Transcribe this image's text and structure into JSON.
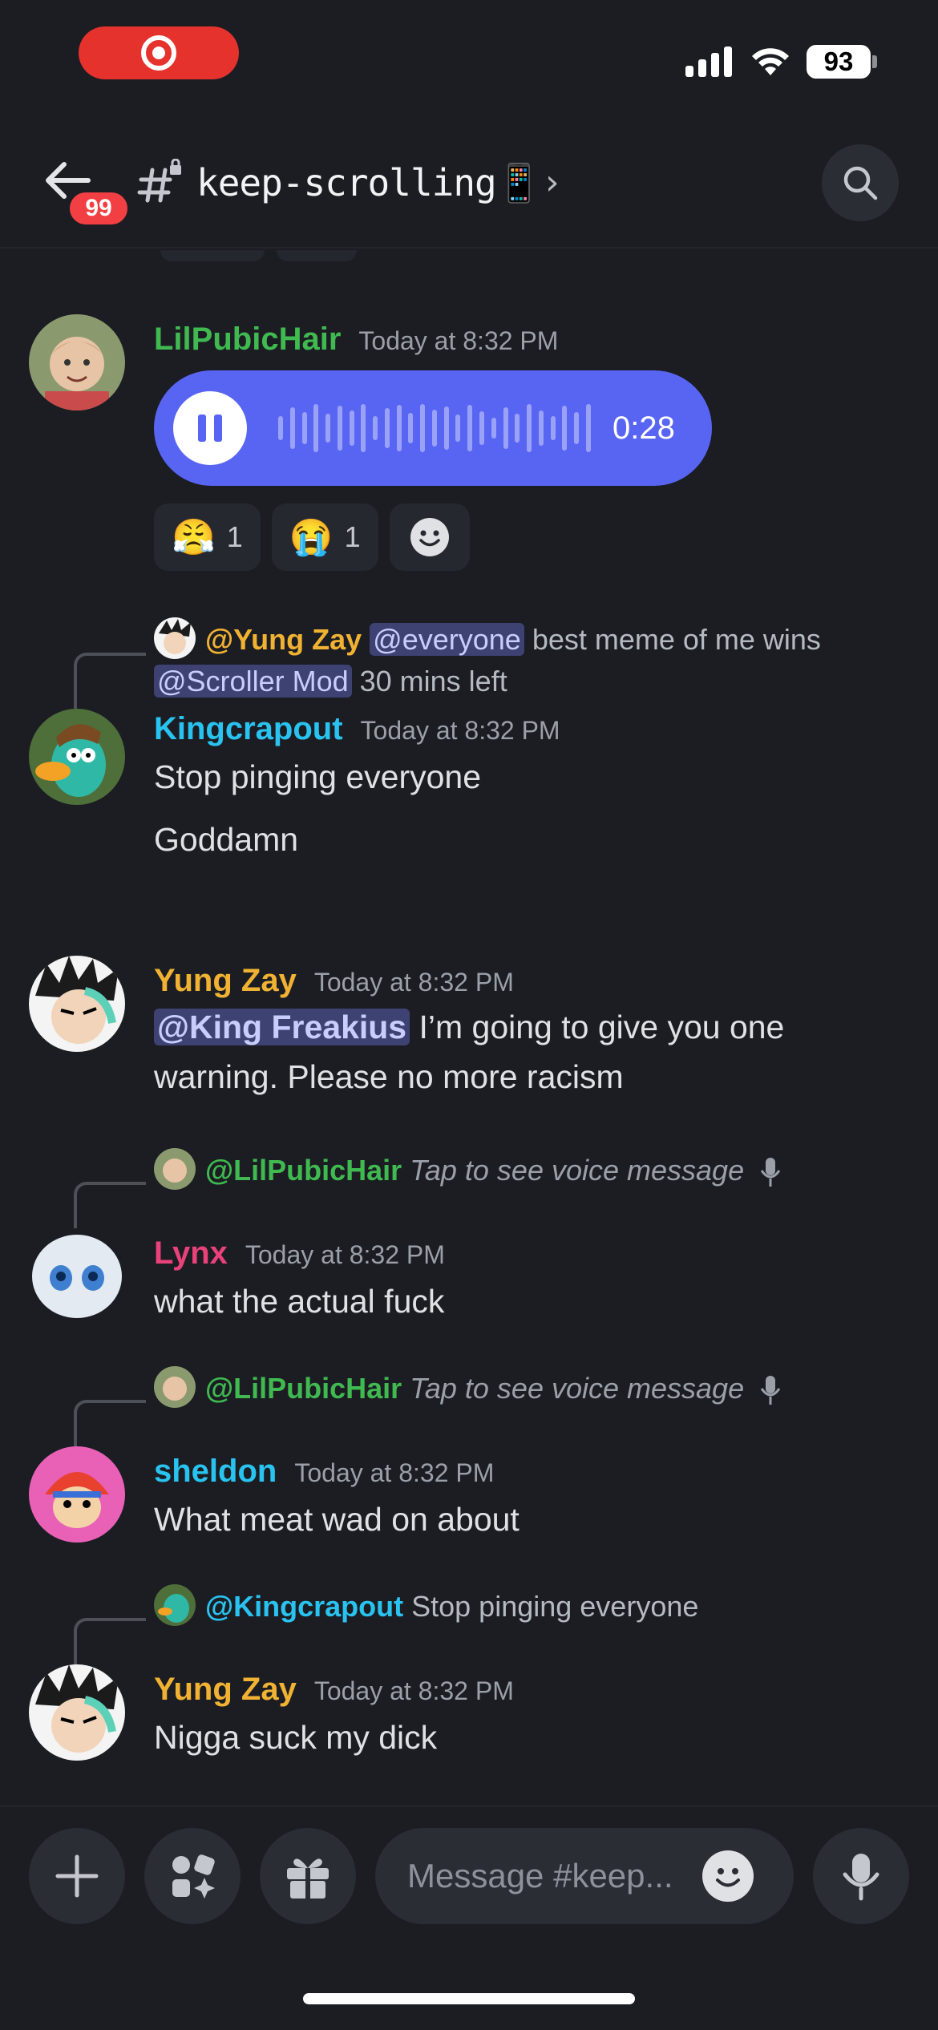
{
  "status_bar": {
    "battery": "93"
  },
  "header": {
    "unread_badge": "99",
    "channel_name": "keep-scrolling📱"
  },
  "messages": [
    {
      "author": "LilPubicHair",
      "author_color": "#3fb950",
      "time": "Today at 8:32 PM",
      "voice_duration": "0:28",
      "reactions": [
        {
          "emoji": "😤",
          "count": "1"
        },
        {
          "emoji": "😭",
          "count": "1"
        }
      ]
    },
    {
      "reply": {
        "name": "@Yung Zay",
        "mention": "@everyone",
        "text": "best meme of me wins",
        "mention2": "@Scroller Mod",
        "text2": "30 mins left"
      },
      "author": "Kingcrapout",
      "author_color": "#29c3f0",
      "time": "Today at 8:32 PM",
      "lines": [
        "Stop pinging everyone",
        "Goddamn"
      ]
    },
    {
      "author": "Yung Zay",
      "author_color": "#f0b232",
      "time": "Today at 8:32 PM",
      "mention": "@King Freakius",
      "text": " I’m going to give you one warning. Please no more racism"
    },
    {
      "reply": {
        "name": "@LilPubicHair",
        "text": "Tap to see voice message"
      },
      "author": "Lynx",
      "author_color": "#e9417a",
      "time": "Today at 8:32 PM",
      "text": "what the actual fuck"
    },
    {
      "reply": {
        "name": "@LilPubicHair",
        "text": "Tap to see voice message"
      },
      "author": "sheldon",
      "author_color": "#29c3f0",
      "time": "Today at 8:32 PM",
      "text": "What meat wad on about"
    },
    {
      "reply": {
        "name": "@Kingcrapout",
        "text": "Stop pinging everyone"
      },
      "author": "Yung Zay",
      "author_color": "#f0b232",
      "time": "Today at 8:32 PM",
      "text": "Nigga suck my dick"
    }
  ],
  "composer": {
    "placeholder": "Message #keep..."
  }
}
